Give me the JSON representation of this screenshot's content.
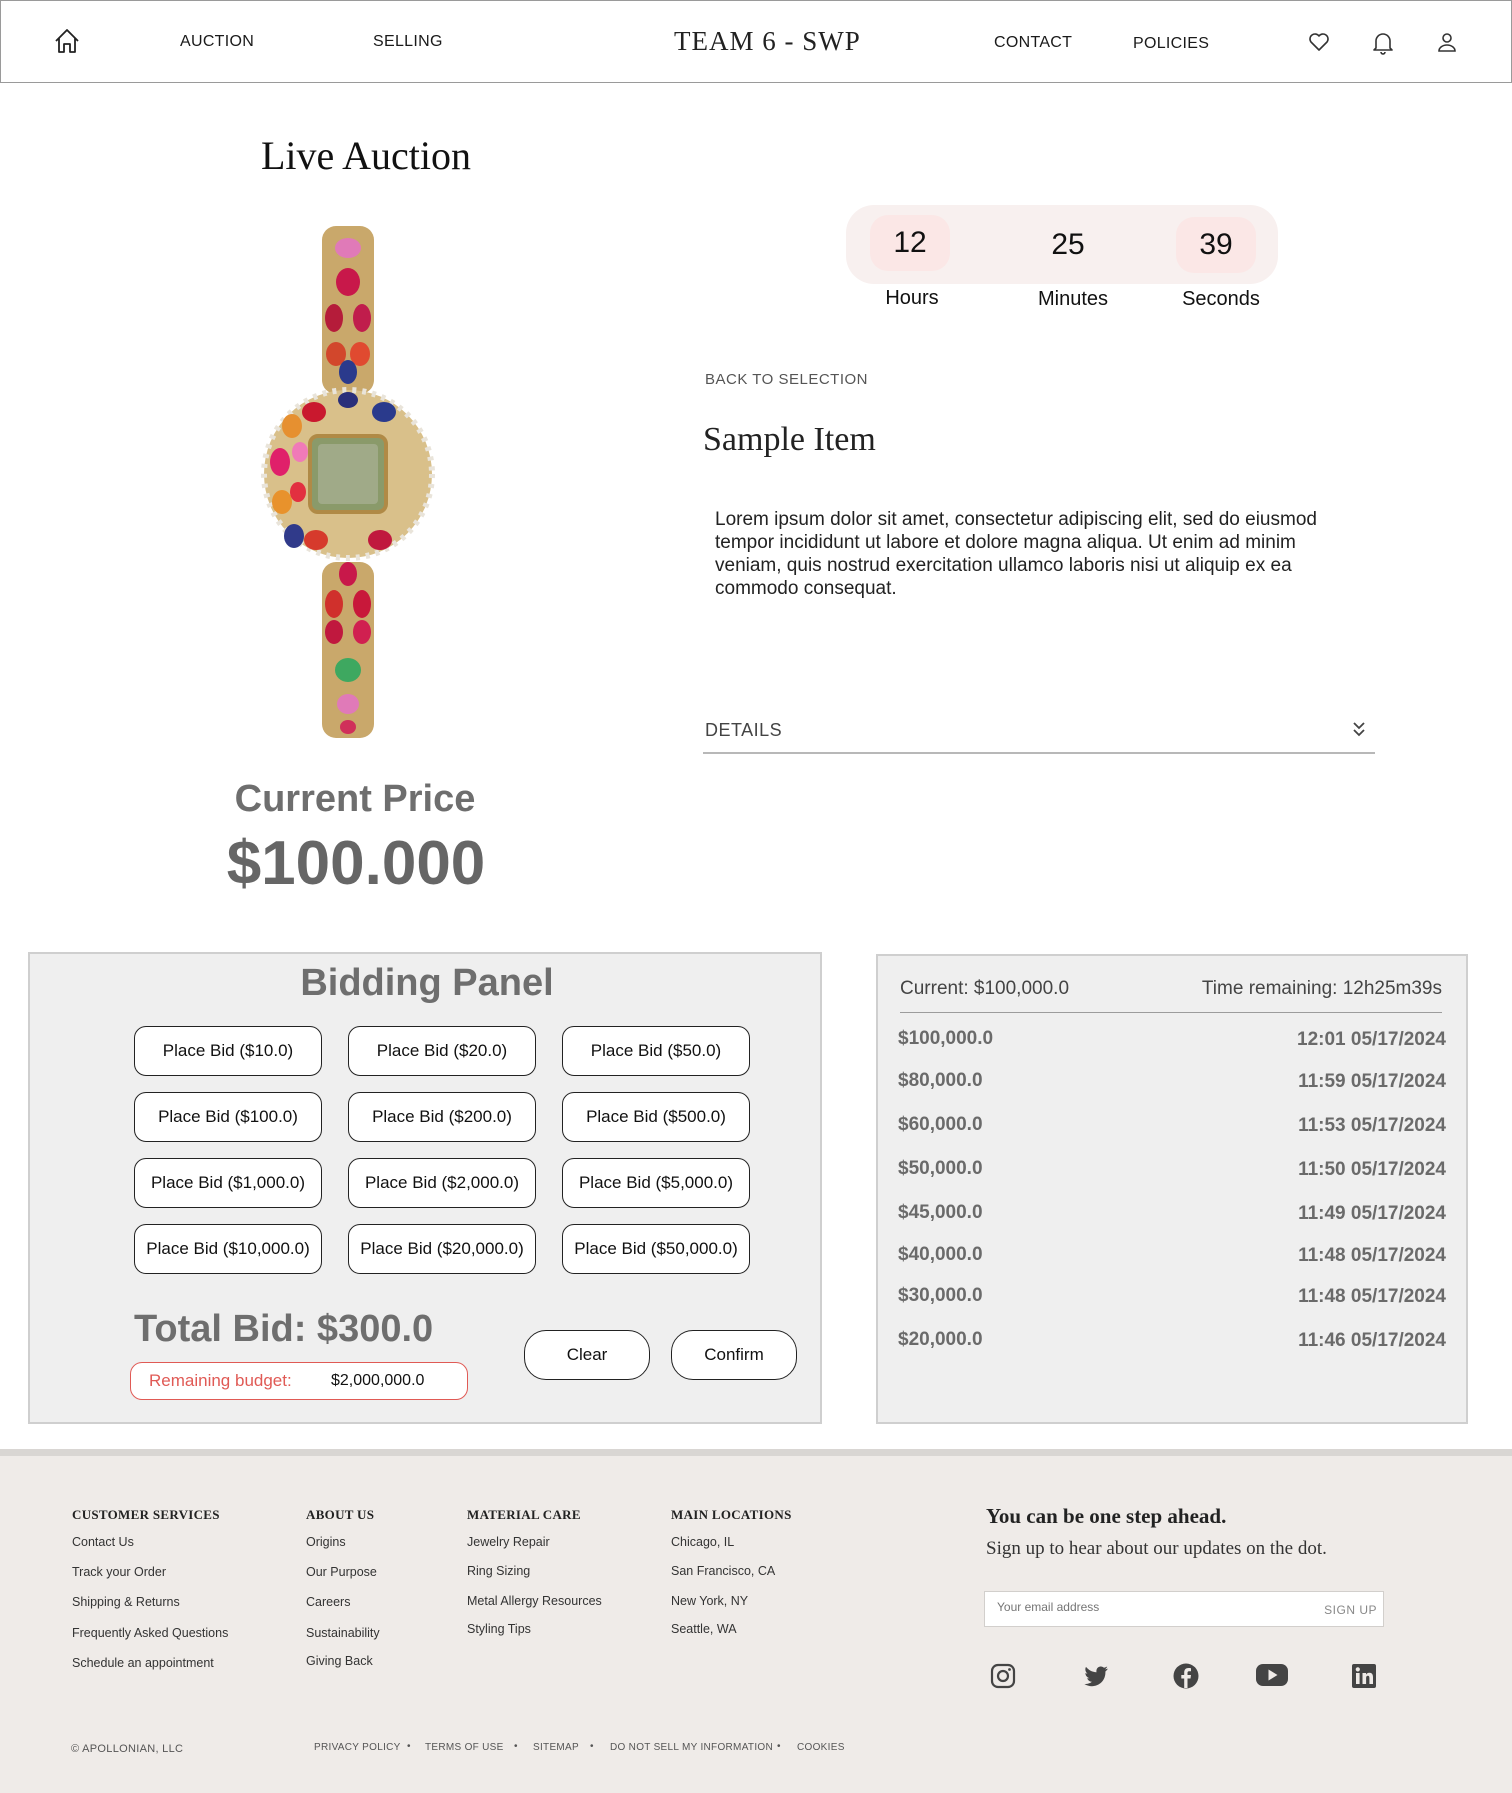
{
  "header": {
    "nav_left": [
      "AUCTION",
      "SELLING"
    ],
    "brand": "TEAM 6 - SWP",
    "nav_right": [
      "CONTACT",
      "POLICIES"
    ],
    "icons": [
      "home-icon",
      "heart-icon",
      "bell-icon",
      "user-icon"
    ]
  },
  "page_title": "Live Auction",
  "countdown": {
    "hours": "12",
    "minutes": "25",
    "seconds": "39",
    "hours_label": "Hours",
    "minutes_label": "Minutes",
    "seconds_label": "Seconds"
  },
  "item": {
    "back_link": "BACK TO SELECTION",
    "title": "Sample Item",
    "description": "Lorem ipsum dolor sit amet, consectetur adipiscing elit, sed do eiusmod tempor incididunt ut labore et dolore magna aliqua. Ut enim ad minim veniam, quis nostrud exercitation ullamco laboris nisi ut aliquip ex ea commodo consequat.",
    "details_label": "DETAILS"
  },
  "price": {
    "label": "Current Price",
    "value": "$100.000"
  },
  "bidding_panel": {
    "title": "Bidding Panel",
    "bid_buttons": [
      "Place Bid ($10.0)",
      "Place Bid ($20.0)",
      "Place Bid ($50.0)",
      "Place Bid ($100.0)",
      "Place Bid ($200.0)",
      "Place Bid ($500.0)",
      "Place Bid ($1,000.0)",
      "Place Bid ($2,000.0)",
      "Place Bid ($5,000.0)",
      "Place Bid ($10,000.0)",
      "Place Bid ($20,000.0)",
      "Place Bid ($50,000.0)"
    ],
    "total_bid": "Total Bid: $300.0",
    "budget_label": "Remaining budget:",
    "budget_value": "$2,000,000.0",
    "clear_label": "Clear",
    "confirm_label": "Confirm"
  },
  "history": {
    "current": "Current: $100,000.0",
    "time_remaining": "Time remaining: 12h25m39s",
    "rows": [
      {
        "amount": "$100,000.0",
        "time": "12:01 05/17/2024"
      },
      {
        "amount": "$80,000.0",
        "time": "11:59 05/17/2024"
      },
      {
        "amount": "$60,000.0",
        "time": "11:53 05/17/2024"
      },
      {
        "amount": "$50,000.0",
        "time": "11:50 05/17/2024"
      },
      {
        "amount": "$45,000.0",
        "time": "11:49 05/17/2024"
      },
      {
        "amount": "$40,000.0",
        "time": "11:48 05/17/2024"
      },
      {
        "amount": "$30,000.0",
        "time": "11:48 05/17/2024"
      },
      {
        "amount": "$20,000.0",
        "time": "11:46 05/17/2024"
      }
    ]
  },
  "footer": {
    "columns": [
      {
        "heading": "CUSTOMER SERVICES",
        "links": [
          "Contact Us",
          "Track your Order",
          "Shipping & Returns",
          "Frequently Asked Questions",
          "Schedule an appointment"
        ]
      },
      {
        "heading": "ABOUT US",
        "links": [
          "Origins",
          "Our Purpose",
          "Careers",
          "Sustainability",
          "Giving Back"
        ]
      },
      {
        "heading": "MATERIAL CARE",
        "links": [
          "Jewelry Repair",
          "Ring Sizing",
          "Metal Allergy Resources",
          "Styling Tips"
        ]
      },
      {
        "heading": "MAIN LOCATIONS",
        "links": [
          "Chicago, IL",
          "San Francisco, CA",
          "New York, NY",
          "Seattle, WA"
        ]
      }
    ],
    "newsletter": {
      "heading": "You can be one step ahead.",
      "sub": "Sign up to hear about our updates on the dot.",
      "placeholder": "Your email address",
      "signup_label": "SIGN UP"
    },
    "social": [
      "instagram-icon",
      "twitter-icon",
      "facebook-icon",
      "youtube-icon",
      "linkedin-icon"
    ],
    "copyright": "©  APOLLONIAN, LLC",
    "legal_links": [
      "PRIVACY POLICY",
      "TERMS OF USE",
      "SITEMAP",
      "DO NOT SELL MY INFORMATION",
      "COOKIES"
    ],
    "separator": "•"
  }
}
